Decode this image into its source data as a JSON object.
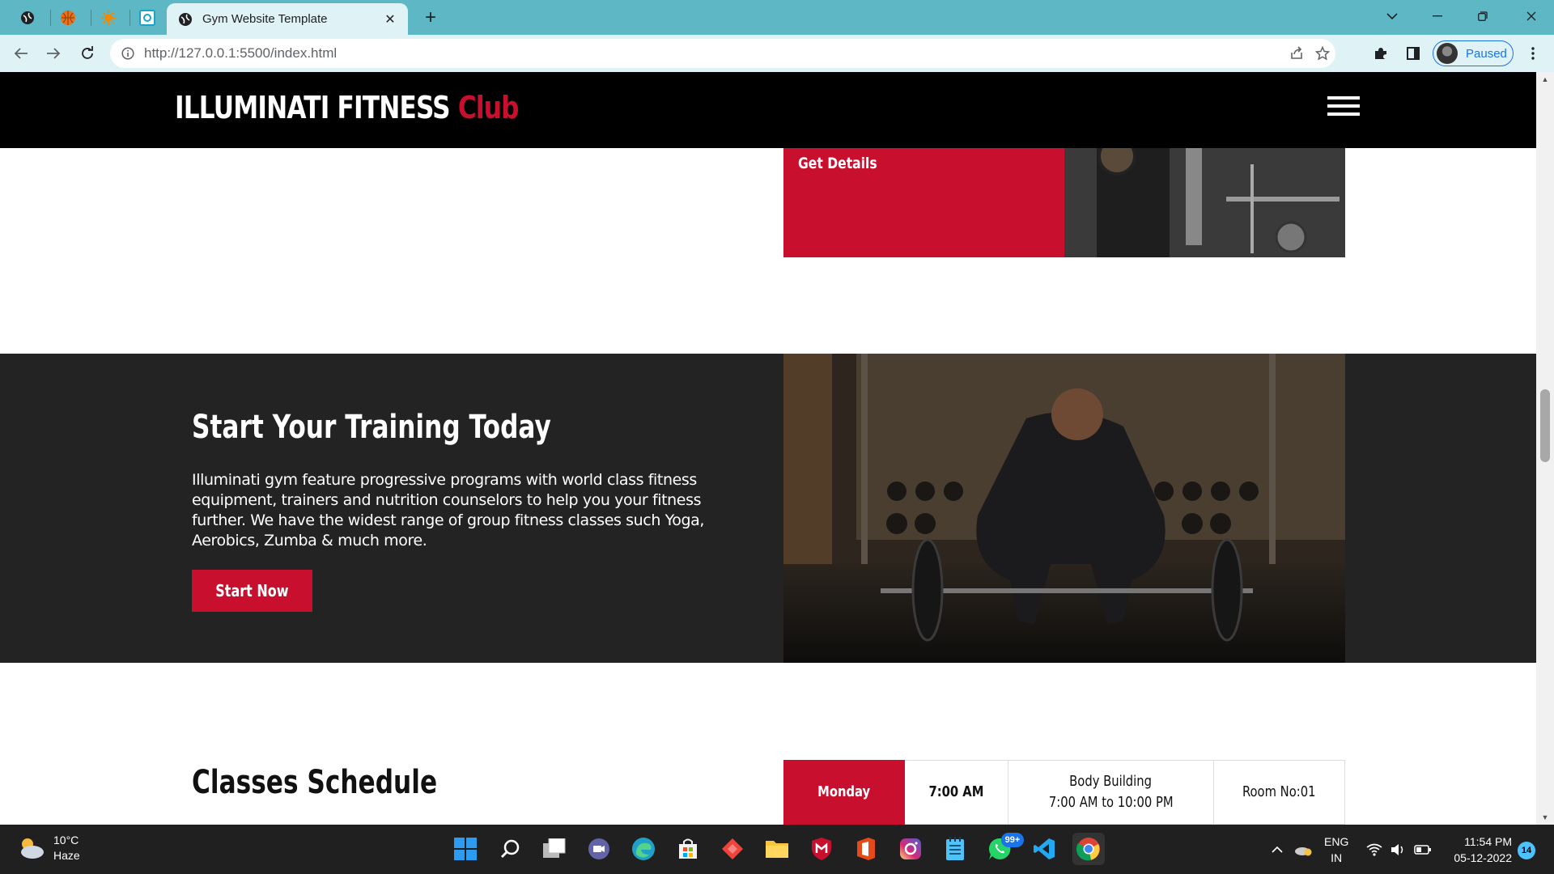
{
  "browser": {
    "active_tab_title": "Gym Website Template",
    "url": "http://127.0.0.1:5500/index.html",
    "profile_status": "Paused",
    "pinned_tabs": [
      "globe-icon",
      "sports-icon",
      "sun-icon",
      "image-icon"
    ]
  },
  "site": {
    "logo_main": "ILLUMINATI FITNESS",
    "logo_accent": "Club",
    "brand_color": "#c8102e",
    "card_cta": "Get Details",
    "training": {
      "title": "Start Your Training Today",
      "body": "Illuminati gym feature progressive programs with world class fitness equipment, trainers and nutrition counselors to help you your fitness further. We have the widest range of group fitness classes such Yoga, Aerobics, Zumba & much more.",
      "button": "Start Now"
    },
    "schedule": {
      "title": "Classes Schedule",
      "rows": [
        {
          "day": "Monday",
          "time": "7:00 AM",
          "class_name": "Body Building",
          "hours": "7:00 AM to 10:00 PM",
          "room": "Room No:01"
        }
      ]
    }
  },
  "taskbar": {
    "weather_temp": "10°C",
    "weather_desc": "Haze",
    "whatsapp_badge": "99+",
    "lang_top": "ENG",
    "lang_bottom": "IN",
    "time": "11:54 PM",
    "date": "05-12-2022",
    "notifications": "14"
  }
}
